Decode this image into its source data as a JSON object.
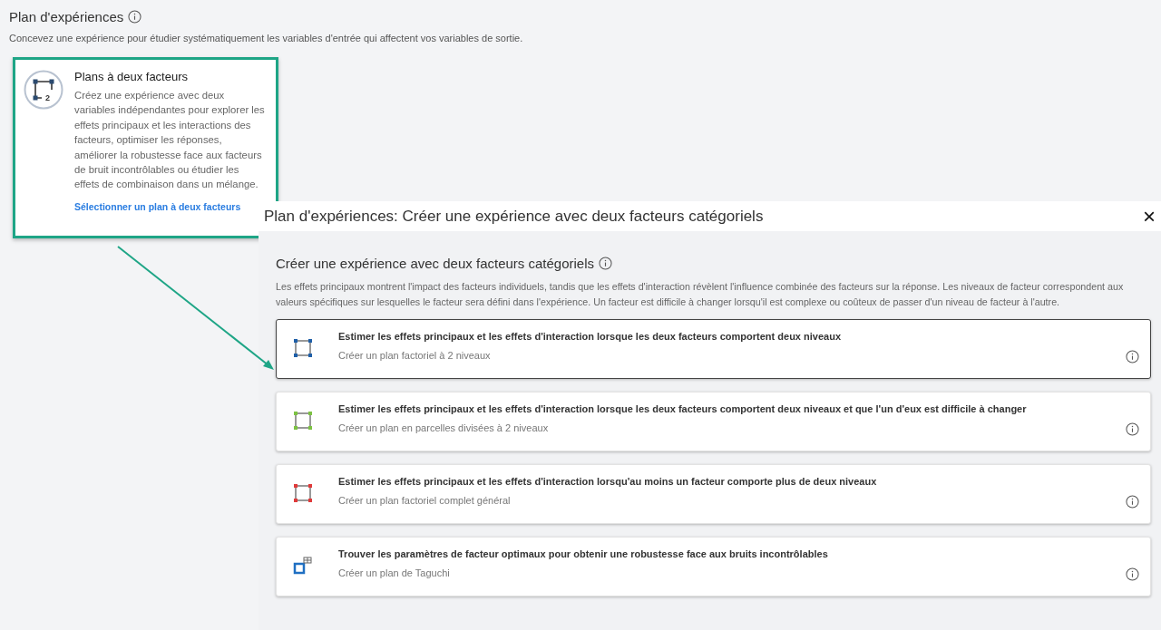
{
  "page": {
    "title": "Plan d'expériences",
    "description": "Concevez une expérience pour étudier systématiquement les variables d'entrée qui affectent vos variables de sortie."
  },
  "card": {
    "title": "Plans à deux facteurs",
    "icon_badge": "2",
    "description": "Créez une expérience avec deux variables indépendantes pour explorer les effets principaux et les interactions des facteurs, optimiser les réponses, améliorer la robustesse face aux facteurs de bruit incontrôlables ou étudier les effets de combinaison dans un mélange.",
    "link": "Sélectionner un plan à deux facteurs",
    "highlighted": true
  },
  "dialog": {
    "title": "Plan d'expériences: Créer une expérience avec deux facteurs catégoriels",
    "close": "×",
    "heading": "Créer une expérience avec deux facteurs catégoriels",
    "description": "Les effets principaux montrent l'impact des facteurs individuels, tandis que les effets d'interaction révèlent l'influence combinée des facteurs sur la réponse. Les niveaux de facteur correspondent aux valeurs spécifiques sur lesquelles le facteur sera défini dans l'expérience. Un facteur est difficile à changer lorsqu'il est complexe ou coûteux de passer d'un niveau de facteur à l'autre.",
    "options": [
      {
        "kind": "square",
        "color": "#1f5fa8",
        "title": "Estimer les effets principaux et les effets d'interaction lorsque les deux facteurs comportent deux niveaux",
        "subtitle": "Créer un plan factoriel à 2 niveaux",
        "selected": true
      },
      {
        "kind": "square",
        "color": "#7cc242",
        "title": "Estimer les effets principaux et les effets d'interaction lorsque les deux facteurs comportent deux niveaux et que l'un d'eux est difficile à changer",
        "subtitle": "Créer un plan en parcelles divisées à 2 niveaux",
        "selected": false
      },
      {
        "kind": "square",
        "color": "#e03a3a",
        "title": "Estimer les effets principaux et les effets d'interaction lorsqu'au moins un facteur comporte plus de deux niveaux",
        "subtitle": "Créer un plan factoriel complet général",
        "selected": false
      },
      {
        "kind": "taguchi",
        "color": "#1f6fc2",
        "title": "Trouver les paramètres de facteur optimaux pour obtenir une robustesse face aux bruits incontrôlables",
        "subtitle": "Créer un plan de Taguchi",
        "selected": false
      }
    ]
  }
}
